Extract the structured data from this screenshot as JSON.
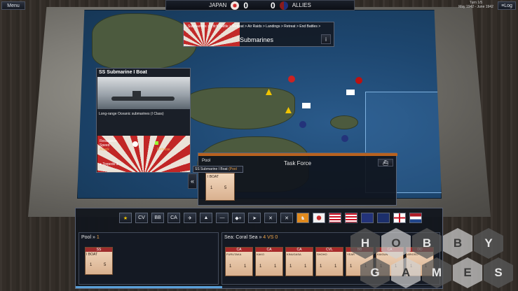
{
  "top_bar": {
    "menu_label": "Menu",
    "japan_label": "JAPAN",
    "japan_score": "0",
    "allies_score": "0",
    "allies_label": "ALLIES",
    "turn_label": "Turn 1/5",
    "turn_dates": "May 1942 - June 1942",
    "log_label": "Log"
  },
  "phase_panel": {
    "breadcrumb": "Submarines > Pitch Battle > Retreat > Air Raids > Landings > Retreat > End Battles >",
    "title": "Submarines",
    "info_label": "i"
  },
  "unit_card": {
    "title": "SS Submarine I Boat",
    "subtitle": "Long-range Oceanic submarines (I Class)",
    "stat_resistance": "Resistance",
    "stat_speed": "Speed",
    "stat_attack": "Attack",
    "stat_defense": "Defense",
    "stat_torpedo": "Torpedo 3"
  },
  "task_force": {
    "tab_pool": "Pool",
    "title": "Task Force",
    "selected_unit": "SS Submarine I Boat",
    "selected_unit_suffix": "(Pool",
    "collapse_label": "«",
    "counter": {
      "type": "I BOAT",
      "left": "1",
      "right": "5"
    }
  },
  "toolbar": {
    "tools": [
      {
        "name": "star",
        "label": "★"
      },
      {
        "name": "cv",
        "label": "CV"
      },
      {
        "name": "bb",
        "label": "BB"
      },
      {
        "name": "ca",
        "label": "CA"
      },
      {
        "name": "plane",
        "label": "✈"
      },
      {
        "name": "bomber",
        "label": "▲"
      },
      {
        "name": "dash",
        "label": "—"
      },
      {
        "name": "ship-plus",
        "label": "◆+"
      },
      {
        "name": "ship-arrow",
        "label": "➤"
      },
      {
        "name": "cross-plane",
        "label": "✕"
      },
      {
        "name": "cross-plane-2",
        "label": "✕"
      },
      {
        "name": "boot",
        "label": "♞"
      }
    ],
    "flags": [
      "japan",
      "us",
      "us",
      "uk",
      "australia",
      "uk-white",
      "netherlands"
    ],
    "colors": {
      "japan": "#c92b2b",
      "us": "#3a4b8f",
      "uk": "#23337a",
      "australia": "#1c2f6b",
      "netherlands": "#ae1c28"
    }
  },
  "pool_panel": {
    "title": "Pool",
    "chevron": "»",
    "count": "1",
    "counter": {
      "type_top": "SS",
      "name": "I BOAT",
      "left": "1",
      "right": "5"
    }
  },
  "sea_panel": {
    "title": "Sea: Coral Sea",
    "chevron": "»",
    "vs_text": "4 VS 0",
    "counters": [
      {
        "type": "CA",
        "name": "FURUTAKA",
        "left": "1",
        "right": "1"
      },
      {
        "type": "CA",
        "name": "KAKO",
        "left": "1",
        "right": "1"
      },
      {
        "type": "CA",
        "name": "KINUGASA",
        "left": "1",
        "right": "1"
      },
      {
        "type": "CVL",
        "name": "SHOHO",
        "left": "1",
        "right": "1"
      },
      {
        "type": "BB",
        "name": "YEAR",
        "left": "1",
        "right": "1"
      },
      {
        "type": "CA",
        "name": "KAIGUN",
        "left": "1",
        "right": "1"
      },
      {
        "type": "DD",
        "name": "ARIOSO",
        "left": "1",
        "right": "1"
      }
    ]
  },
  "watermark": {
    "line1": [
      "H",
      "O",
      "B",
      "B",
      "Y"
    ],
    "line2": [
      "G",
      "A",
      "M",
      "E",
      "S"
    ]
  }
}
